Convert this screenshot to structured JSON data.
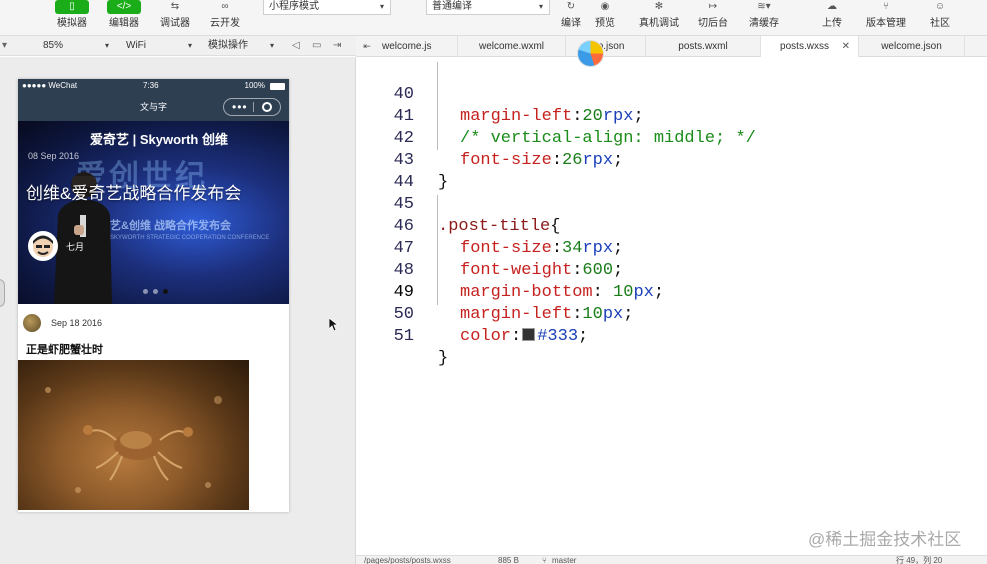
{
  "toolbar": {
    "simulator": "模拟器",
    "editor": "编辑器",
    "debugger": "调试器",
    "cloud": "云开发",
    "mode_select": "小程序模式",
    "compile_select": "普通编译",
    "compile": "编译",
    "preview": "预览",
    "remote_debug": "真机调试",
    "background": "切后台",
    "clear_cache": "清缓存",
    "upload": "上传",
    "version": "版本管理",
    "community": "社区"
  },
  "subbar": {
    "zoom": "85%",
    "network": "WiFi",
    "operation": "模拟操作"
  },
  "phone": {
    "carrier": "●●●●● WeChat",
    "time": "7:36",
    "battery": "100%",
    "nav_title": "文与字",
    "banner": {
      "logo": "爱奇艺 | Skyworth 创维",
      "ghost_big": "爱创世纪",
      "ghost_line": "艺&创维 战略合作发布会",
      "ghost_small": "SKYWORTH STRATEGIC COOPERATION CONFERENCE",
      "date": "08 Sep 2016",
      "title": "创维&爱奇艺战略合作发布会",
      "author": "七月"
    },
    "post": {
      "date": "Sep 18 2016",
      "title": "正是虾肥蟹壮时"
    }
  },
  "tabs": [
    {
      "label": "welcome.js"
    },
    {
      "label": "welcome.wxml"
    },
    {
      "label": "app.json"
    },
    {
      "label": "posts.wxml"
    },
    {
      "label": "posts.wxss"
    },
    {
      "label": "welcome.json"
    }
  ],
  "code": {
    "l40": {
      "no": "40",
      "prop": "margin-left",
      "val": "20",
      "unit": "rpx"
    },
    "l41": {
      "no": "41",
      "comment": "/* vertical-align: middle; */"
    },
    "l42": {
      "no": "42",
      "prop": "font-size",
      "val": "26",
      "unit": "rpx"
    },
    "l43": {
      "no": "43",
      "text": "}"
    },
    "l44": {
      "no": "44"
    },
    "l45": {
      "no": "45",
      "selector": ".post-title",
      "brace": "{"
    },
    "l46": {
      "no": "46",
      "prop": "font-size",
      "val": "34",
      "unit": "rpx"
    },
    "l47": {
      "no": "47",
      "prop": "font-weight",
      "val": "600"
    },
    "l48": {
      "no": "48",
      "prop": "margin-bottom",
      "val": "10",
      "unit": "px"
    },
    "l49": {
      "no": "49",
      "prop": "margin-left",
      "val": "10",
      "unit": "px"
    },
    "l50": {
      "no": "50",
      "prop": "color",
      "val": "#333"
    },
    "l51": {
      "no": "51",
      "text": "}"
    }
  },
  "statusbar": {
    "path": "/pages/posts/posts.wxss",
    "size": "885 B",
    "branch": "master",
    "position": "行 49，列 20"
  },
  "watermark": "@稀土掘金技术社区",
  "colors": {
    "accent_green": "#1aad19",
    "nav_bg": "#2f3f52",
    "swatch": "#333333"
  }
}
